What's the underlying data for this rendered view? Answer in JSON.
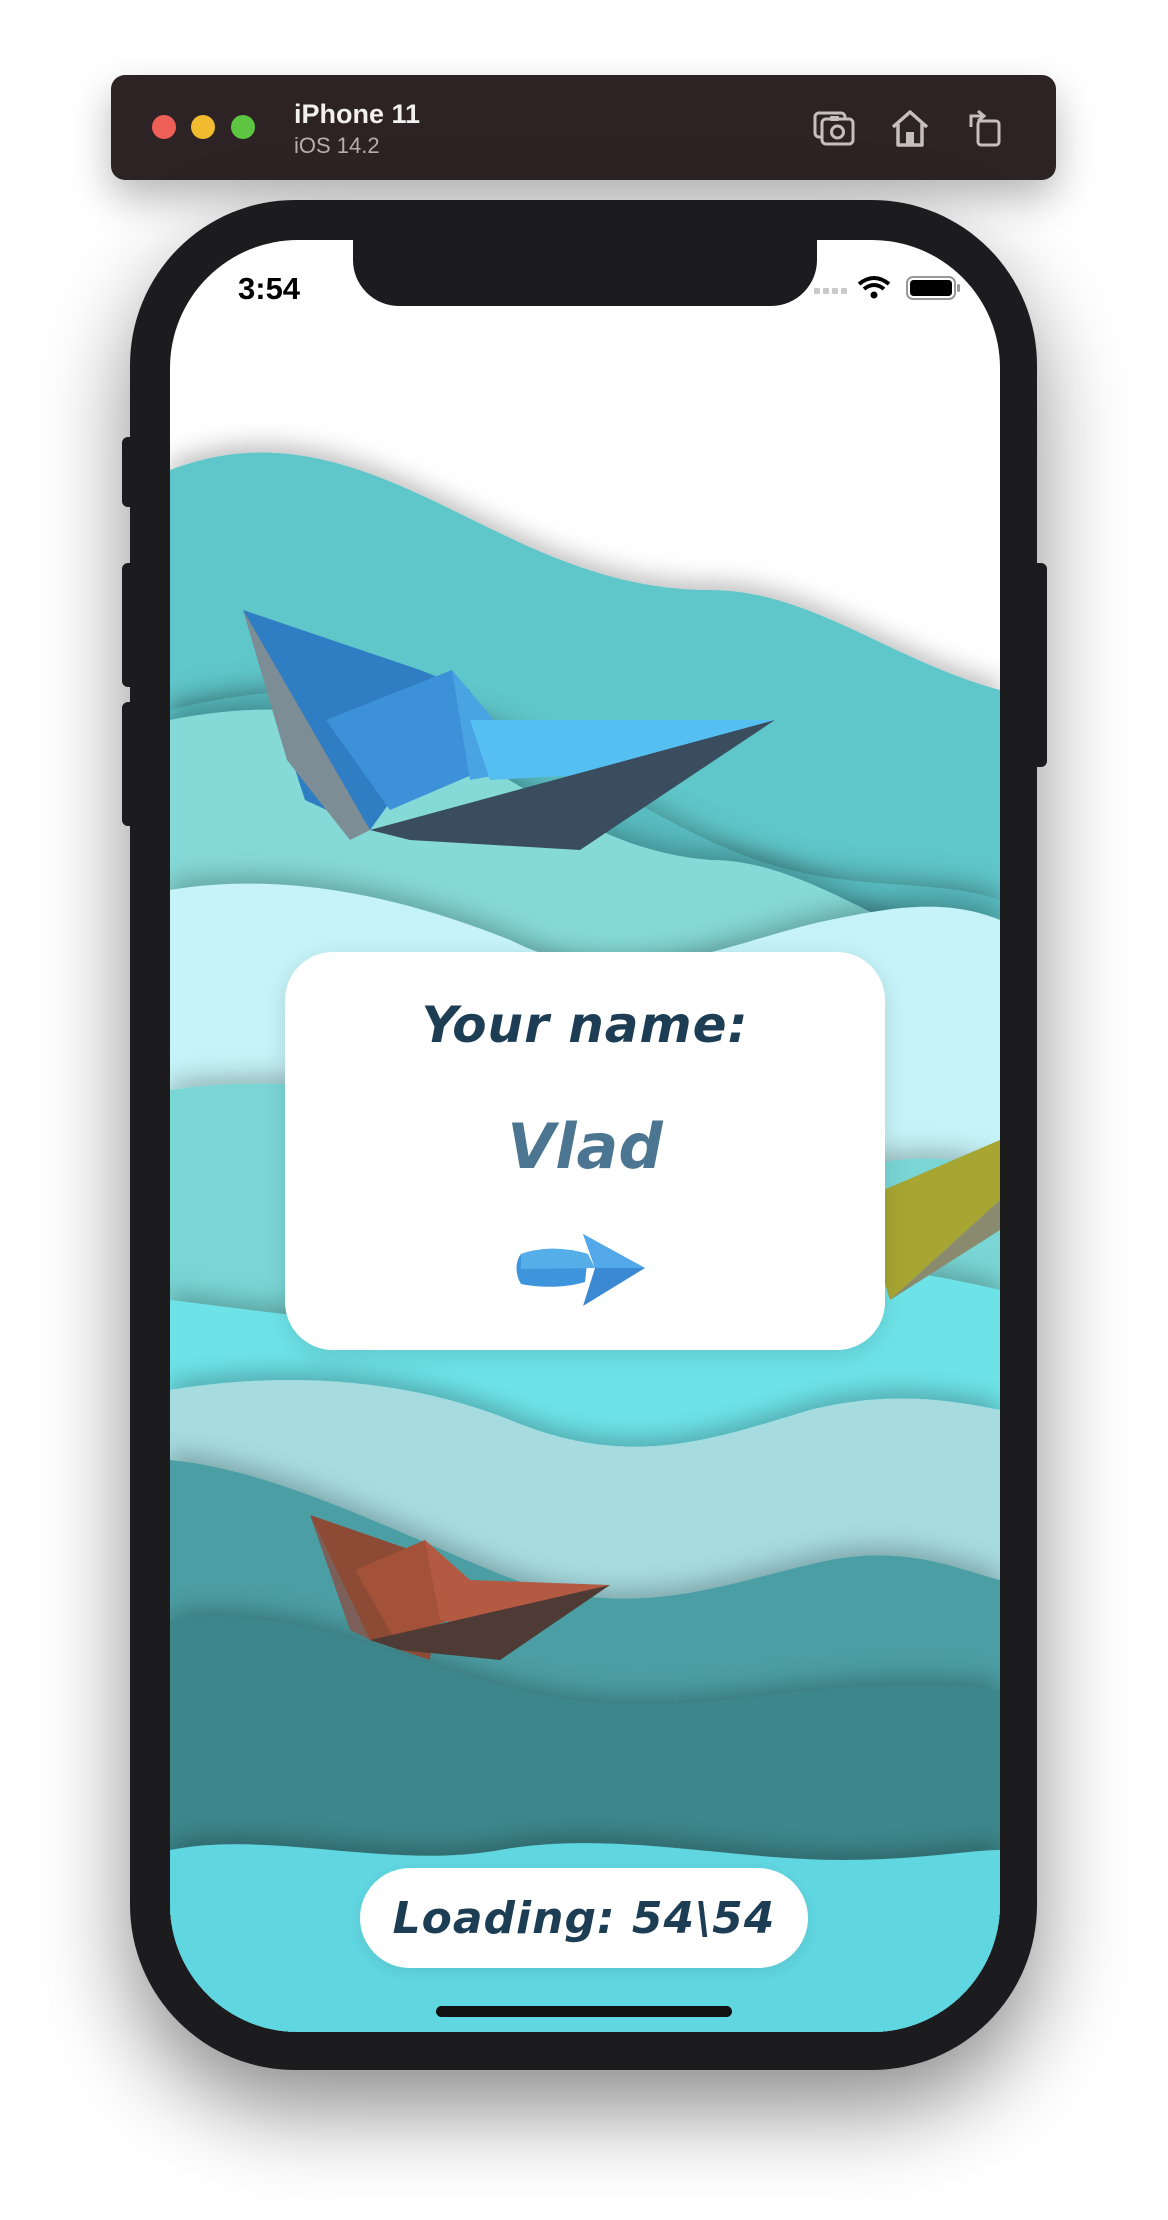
{
  "simulator": {
    "device_name": "iPhone 11",
    "os_version": "iOS 14.2",
    "icons": [
      "screenshot-icon",
      "home-icon",
      "rotate-icon"
    ]
  },
  "status_bar": {
    "time": "3:54",
    "icons": [
      "signal-icon",
      "wifi-icon",
      "battery-icon"
    ]
  },
  "card": {
    "label": "Your name:",
    "name_value": "Vlad",
    "next_icon": "arrow-right-icon"
  },
  "loading": {
    "label": "Loading:",
    "current": "54",
    "separator": "\\",
    "total": "54",
    "text": "Loading: 54\\54"
  },
  "colors": {
    "title_text": "#1c3d54",
    "name_text": "#4b7590",
    "arrow": "#3d8fd9"
  }
}
